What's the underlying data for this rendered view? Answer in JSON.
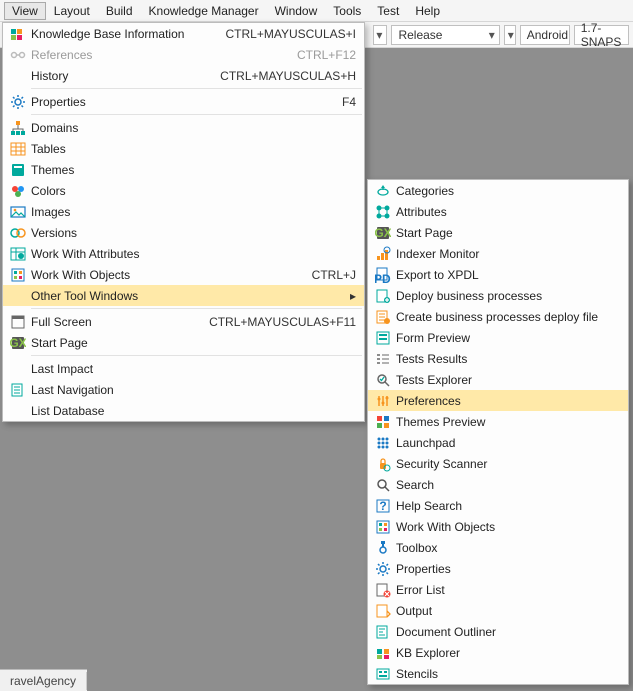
{
  "menubar": {
    "items": [
      "View",
      "Layout",
      "Build",
      "Knowledge Manager",
      "Window",
      "Tools",
      "Test",
      "Help"
    ],
    "active_index": 0
  },
  "toolbar": {
    "combo1": {
      "value": "Release"
    },
    "platform": "Android",
    "version": "1.7-SNAPS"
  },
  "view_menu": {
    "items": [
      {
        "icon": "kb-info-icon",
        "label": "Knowledge Base Information",
        "shortcut": "CTRL+MAYUSCULAS+I"
      },
      {
        "icon": "refs-icon",
        "label": "References",
        "shortcut": "CTRL+F12",
        "disabled": true
      },
      {
        "icon": "",
        "label": "History",
        "shortcut": "CTRL+MAYUSCULAS+H"
      },
      {
        "sep": true
      },
      {
        "icon": "gear-icon",
        "label": "Properties",
        "shortcut": "F4"
      },
      {
        "sep": true
      },
      {
        "icon": "domains-icon",
        "label": "Domains"
      },
      {
        "icon": "tables-icon",
        "label": "Tables"
      },
      {
        "icon": "themes-icon",
        "label": "Themes"
      },
      {
        "icon": "colors-icon",
        "label": "Colors"
      },
      {
        "icon": "images-icon",
        "label": "Images"
      },
      {
        "icon": "versions-icon",
        "label": "Versions"
      },
      {
        "icon": "workattr-icon",
        "label": "Work With Attributes"
      },
      {
        "icon": "workobj-icon",
        "label": "Work With Objects",
        "shortcut": "CTRL+J"
      },
      {
        "icon": "",
        "label": "Other Tool Windows",
        "submenu": true,
        "highlight": true
      },
      {
        "sep": true
      },
      {
        "icon": "fullscreen-icon",
        "label": "Full Screen",
        "shortcut": "CTRL+MAYUSCULAS+F11"
      },
      {
        "icon": "startpage-icon",
        "label": "Start Page"
      },
      {
        "sep": true
      },
      {
        "icon": "",
        "label": "Last Impact"
      },
      {
        "icon": "lastnav-icon",
        "label": "Last Navigation"
      },
      {
        "icon": "",
        "label": "List Database"
      }
    ]
  },
  "submenu": {
    "items": [
      {
        "icon": "categories-icon",
        "label": "Categories"
      },
      {
        "icon": "attributes-icon",
        "label": "Attributes"
      },
      {
        "icon": "startpage-icon",
        "label": "Start Page"
      },
      {
        "icon": "indexer-icon",
        "label": "Indexer Monitor"
      },
      {
        "icon": "xpdl-icon",
        "label": "Export to XPDL"
      },
      {
        "icon": "deploy-icon",
        "label": "Deploy business processes"
      },
      {
        "icon": "deployfile-icon",
        "label": "Create business processes deploy file"
      },
      {
        "icon": "formprev-icon",
        "label": "Form Preview"
      },
      {
        "icon": "tests-icon",
        "label": "Tests Results"
      },
      {
        "icon": "testexp-icon",
        "label": "Tests Explorer"
      },
      {
        "icon": "prefs-icon",
        "label": "Preferences",
        "highlight": true
      },
      {
        "icon": "themeprev-icon",
        "label": "Themes Preview"
      },
      {
        "icon": "launchpad-icon",
        "label": "Launchpad"
      },
      {
        "icon": "security-icon",
        "label": "Security Scanner"
      },
      {
        "icon": "search-icon",
        "label": "Search"
      },
      {
        "icon": "helpsearch-icon",
        "label": "Help Search"
      },
      {
        "icon": "workobj-icon",
        "label": "Work With Objects"
      },
      {
        "icon": "toolbox-icon",
        "label": "Toolbox"
      },
      {
        "icon": "gear-icon",
        "label": "Properties"
      },
      {
        "icon": "errorlist-icon",
        "label": "Error List"
      },
      {
        "icon": "output-icon",
        "label": "Output"
      },
      {
        "icon": "docoutline-icon",
        "label": "Document Outliner"
      },
      {
        "icon": "kbexplorer-icon",
        "label": "KB Explorer"
      },
      {
        "icon": "stencils-icon",
        "label": "Stencils"
      }
    ]
  },
  "status": {
    "tab": "ravelAgency"
  },
  "colors": {
    "highlight": "#ffe9a8",
    "accent_teal": "#00a99d",
    "accent_blue": "#1a79c4",
    "accent_orange": "#f7941e"
  }
}
